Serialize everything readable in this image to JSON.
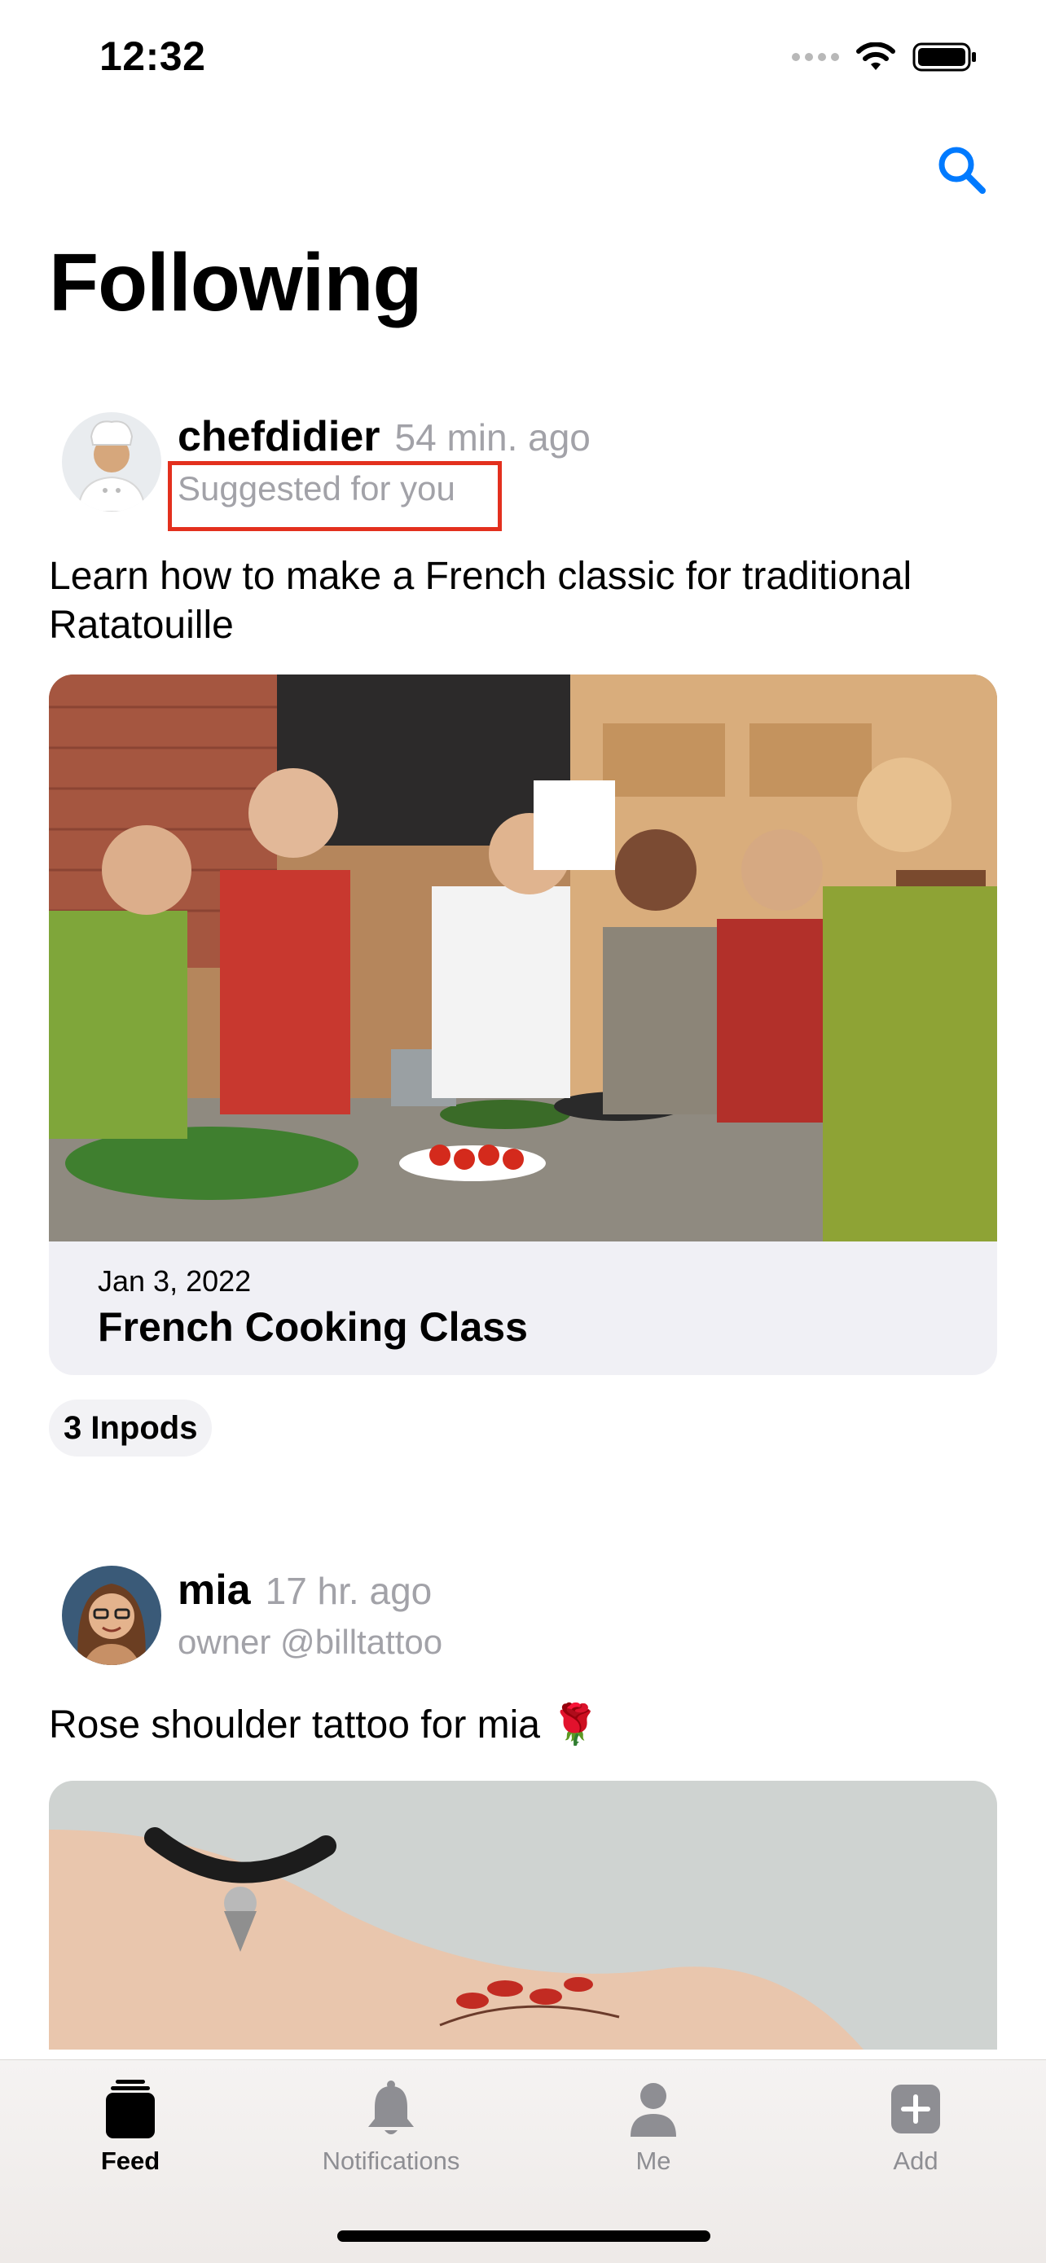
{
  "status_bar": {
    "time": "12:32"
  },
  "header": {
    "title": "Following",
    "search_icon": "search-icon"
  },
  "posts": [
    {
      "username": "chefdidier",
      "time": "54 min. ago",
      "subtitle": "Suggested for you",
      "text": "Learn how to make a French classic for traditional Ratatouille",
      "card": {
        "date": "Jan 3, 2022",
        "title": "French Cooking Class"
      },
      "chip": "3 Inpods"
    },
    {
      "username": "mia",
      "time": "17 hr. ago",
      "subtitle": "owner @billtattoo",
      "text": "Rose shoulder tattoo for mia 🌹"
    }
  ],
  "tabs": [
    {
      "label": "Feed",
      "icon": "feed-icon",
      "active": true
    },
    {
      "label": "Notifications",
      "icon": "bell-icon",
      "active": false
    },
    {
      "label": "Me",
      "icon": "person-icon",
      "active": false
    },
    {
      "label": "Add",
      "icon": "plus-square-icon",
      "active": false
    }
  ],
  "colors": {
    "accent": "#007aff",
    "highlight": "#e3301e",
    "muted_text": "#a2a2a8"
  }
}
